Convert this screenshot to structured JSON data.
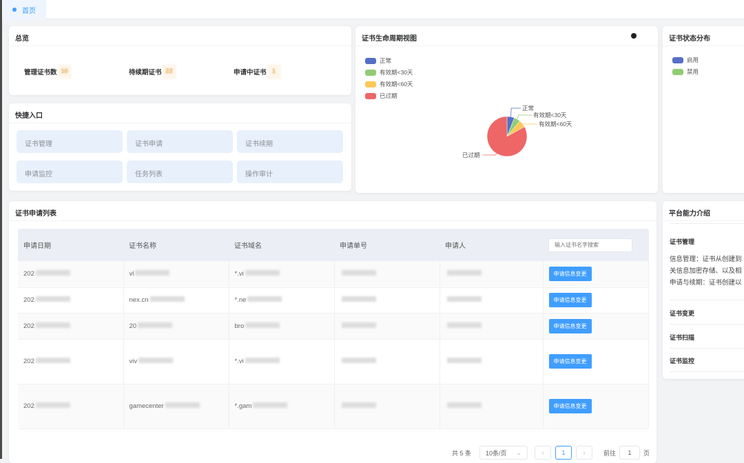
{
  "tabs": [
    {
      "label": "首页",
      "active": true
    }
  ],
  "overview": {
    "title": "总览",
    "stats": [
      {
        "label": "管理证书数",
        "value": "10"
      },
      {
        "label": "待续期证书",
        "value": "22"
      },
      {
        "label": "申请中证书",
        "value": "1"
      }
    ]
  },
  "quick": {
    "title": "快捷入口",
    "items": [
      "证书管理",
      "证书申请",
      "证书续期",
      "申请监控",
      "任务列表",
      "操作审计"
    ]
  },
  "lifecycle": {
    "title": "证书生命周期视图",
    "info_icon": "info-circle-icon",
    "chart_data": {
      "type": "pie",
      "categories": [
        "正常",
        "有效期<30天",
        "有效期<60天",
        "已过期"
      ],
      "values": [
        6,
        5,
        6,
        83
      ],
      "colors": [
        "#5470c6",
        "#91cc75",
        "#fac858",
        "#ee6666"
      ],
      "legend": "top-left"
    }
  },
  "status": {
    "title": "证书状态分布",
    "legend": [
      {
        "label": "启用",
        "color": "#5470c6"
      },
      {
        "label": "禁用",
        "color": "#91cc75"
      }
    ]
  },
  "list": {
    "title": "证书申请列表",
    "columns": [
      "申请日期",
      "证书名称",
      "证书域名",
      "申请单号",
      "申请人"
    ],
    "search_placeholder": "输入证书名字搜索",
    "action_label": "申请信息变更",
    "rows": [
      {
        "date": "202",
        "name": "vl",
        "domain": "*.vi",
        "order": "",
        "applicant": ""
      },
      {
        "date": "202",
        "name": "nex.cn",
        "domain": "*.ne",
        "order": "",
        "applicant": ""
      },
      {
        "date": "202",
        "name": "20",
        "domain": "bro",
        "order": "",
        "applicant": ""
      },
      {
        "date": "202",
        "name": "viv",
        "domain": "*.vi",
        "order": "",
        "applicant": ""
      },
      {
        "date": "202",
        "name": "gamecenter",
        "domain": "*.gam",
        "order": "",
        "applicant": ""
      }
    ],
    "pagination": {
      "total": "共 5 条",
      "page_size": "10条/页",
      "current": "1",
      "goto_label": "前往",
      "goto_value": "1",
      "page_suffix": "页"
    }
  },
  "platform": {
    "title": "平台能力介绍",
    "sections": [
      "证书管理",
      "证书变更",
      "证书扫描",
      "证书监控"
    ],
    "desc": [
      "信息管理：证书从创建到",
      "关信息加密存储、以及相",
      "申请与续期：证书创建以"
    ]
  }
}
